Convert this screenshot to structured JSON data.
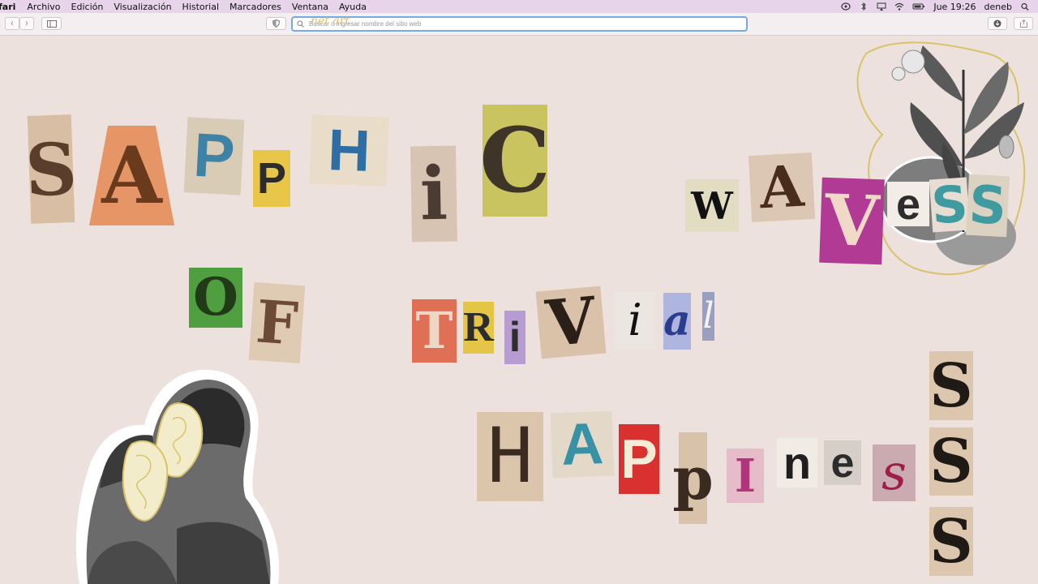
{
  "menubar": {
    "app": "fari",
    "items": [
      "Archivo",
      "Edición",
      "Visualización",
      "Historial",
      "Marcadores",
      "Ventana",
      "Ayuda"
    ],
    "clock": "Jue 19:26",
    "user": "deneb"
  },
  "toolbar": {
    "address_placeholder": "Buscar o ingresar nombre del sitio web",
    "address_watermark": "net art"
  },
  "collage": {
    "line1": [
      "S",
      "A",
      "P",
      "P",
      "H",
      "i",
      "C"
    ],
    "line1b": [
      "W",
      "A",
      "V",
      "e",
      "S",
      "S"
    ],
    "line2": [
      "O",
      "F"
    ],
    "line2b": [
      "T",
      "R",
      "i",
      "V",
      "i",
      "a",
      "l"
    ],
    "line3": [
      "H",
      "A",
      "P",
      "p",
      "I",
      "n",
      "e",
      "s"
    ],
    "column": [
      "S",
      "S",
      "S"
    ]
  },
  "colors": {
    "menubar": "#e7d3ea",
    "background": "#ede1de",
    "address_focus": "#7aa7e6"
  }
}
